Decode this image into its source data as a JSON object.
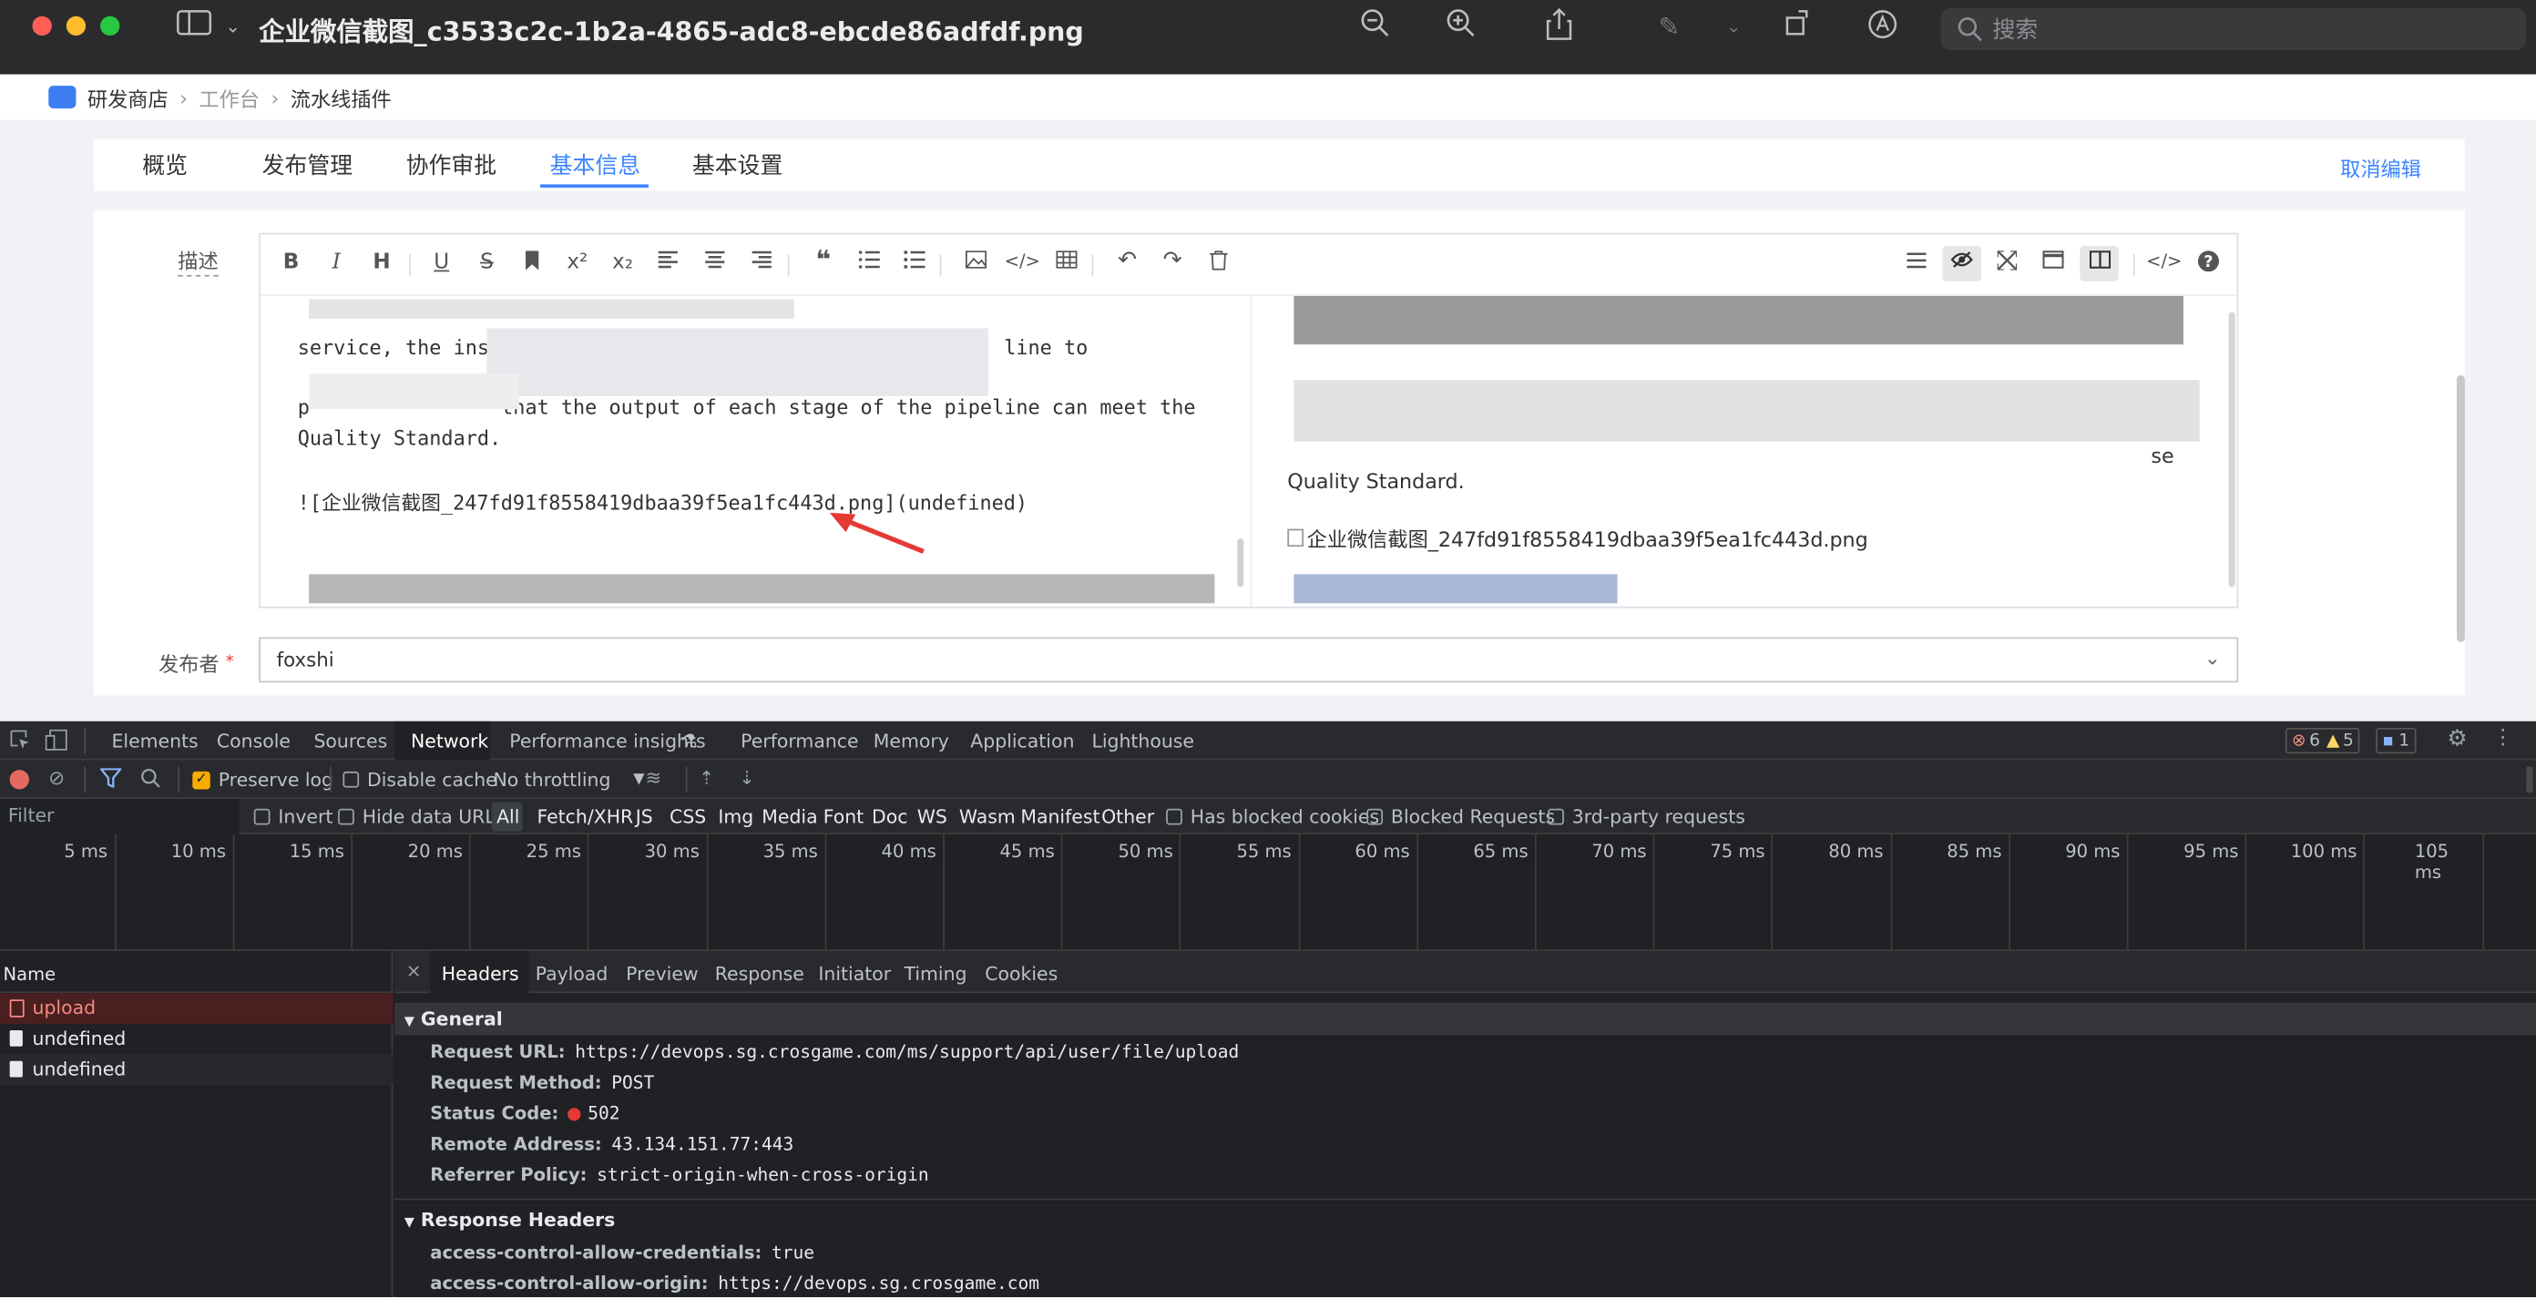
{
  "window": {
    "title": "企业微信截图_c3533c2c-1b2a-4865-adc8-ebcde86adfdf.png",
    "search_placeholder": "搜索"
  },
  "breadcrumb": [
    "研发商店",
    "工作台",
    "流水线插件"
  ],
  "page_tabs": [
    {
      "label": "概览",
      "active": false
    },
    {
      "label": "发布管理",
      "active": false
    },
    {
      "label": "协作审批",
      "active": false
    },
    {
      "label": "基本信息",
      "active": true
    },
    {
      "label": "基本设置",
      "active": false
    }
  ],
  "cancel_edit": "取消编辑",
  "form": {
    "desc_label": "描述",
    "publisher_label": "发布者",
    "publisher_value": "foxshi",
    "required_mark": "*"
  },
  "editor": {
    "left_lines": [
      "service, the insp                                          line to",
      "p                that the output of each stage of the pipeline can meet the",
      "Quality Standard.",
      "",
      "![企业微信截图_247fd91f8558419dbaa39f5ea1fc443d.png](undefined)"
    ],
    "right_lines": [
      "Quality Standard.",
      "企业微信截图_247fd91f8558419dbaa39f5ea1fc443d.png"
    ],
    "right_suffix": "se"
  },
  "devtools": {
    "tabs": [
      "Elements",
      "Console",
      "Sources",
      "Network",
      "Performance insights",
      "Performance",
      "Memory",
      "Application",
      "Lighthouse"
    ],
    "active_tab": "Network",
    "errors": "6",
    "warnings": "5",
    "messages": "1",
    "toolbar": {
      "preserve_log": "Preserve log",
      "disable_cache": "Disable cache",
      "throttle": "No throttling"
    },
    "filter": {
      "placeholder": "Filter",
      "invert": "Invert",
      "hide_data_urls": "Hide data URLs",
      "types": [
        "All",
        "Fetch/XHR",
        "JS",
        "CSS",
        "Img",
        "Media",
        "Font",
        "Doc",
        "WS",
        "Wasm",
        "Manifest",
        "Other"
      ],
      "has_blocked": "Has blocked cookies",
      "blocked_requests": "Blocked Requests",
      "third_party": "3rd-party requests"
    },
    "timeline_ticks": [
      "5 ms",
      "10 ms",
      "15 ms",
      "20 ms",
      "25 ms",
      "30 ms",
      "35 ms",
      "40 ms",
      "45 ms",
      "50 ms",
      "55 ms",
      "60 ms",
      "65 ms",
      "70 ms",
      "75 ms",
      "80 ms",
      "85 ms",
      "90 ms",
      "95 ms",
      "100 ms",
      "105 ms"
    ],
    "name_header": "Name",
    "requests": [
      {
        "name": "upload",
        "error": true
      },
      {
        "name": "undefined",
        "error": false
      },
      {
        "name": "undefined",
        "error": false
      }
    ],
    "detail_tabs": [
      "Headers",
      "Payload",
      "Preview",
      "Response",
      "Initiator",
      "Timing",
      "Cookies"
    ],
    "general_title": "General",
    "general": [
      {
        "k": "Request URL:",
        "v": "https://devops.sg.crosgame.com/ms/support/api/user/file/upload"
      },
      {
        "k": "Request Method:",
        "v": "POST"
      },
      {
        "k": "Status Code:",
        "v": "502"
      },
      {
        "k": "Remote Address:",
        "v": "43.134.151.77:443"
      },
      {
        "k": "Referrer Policy:",
        "v": "strict-origin-when-cross-origin"
      }
    ],
    "response_title": "Response Headers",
    "response": [
      {
        "k": "access-control-allow-credentials:",
        "v": "true"
      },
      {
        "k": "access-control-allow-origin:",
        "v": "https://devops.sg.crosgame.com"
      }
    ],
    "colors": {
      "error": "#f28b82",
      "accent": "#8ab4f8",
      "status_red": "#e53935"
    }
  }
}
